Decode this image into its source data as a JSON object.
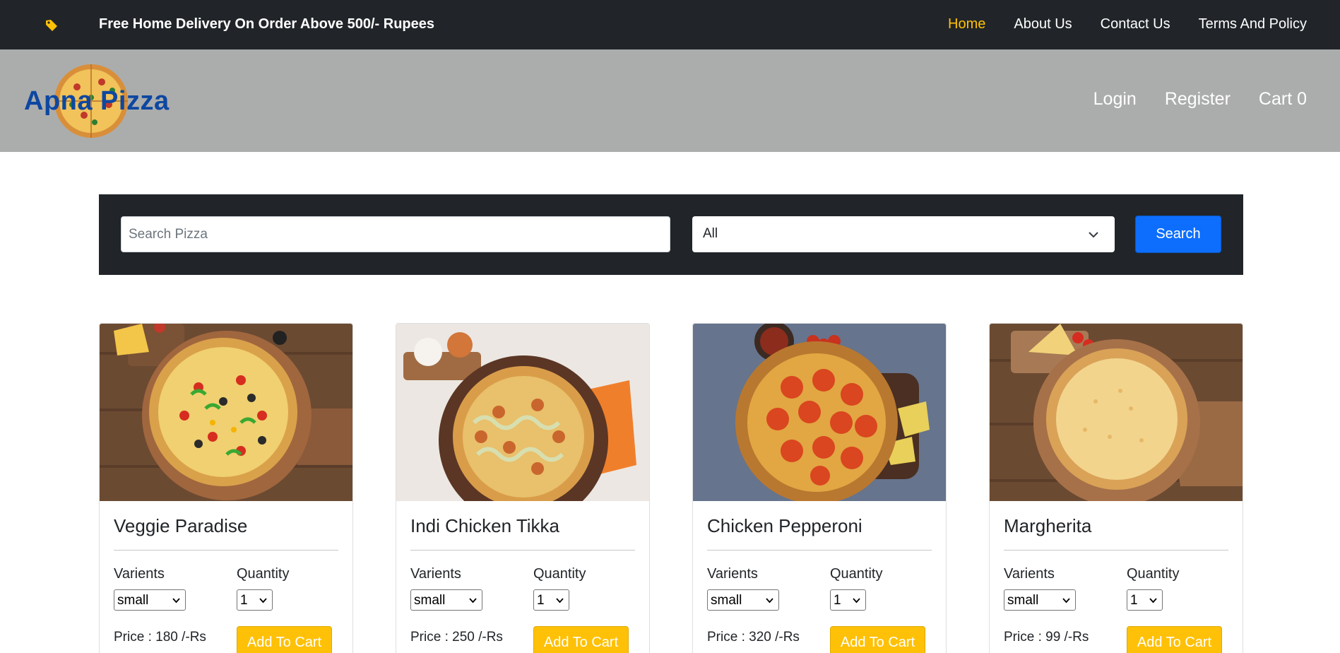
{
  "topbar": {
    "icon": "tag-icon",
    "promo": "Free Home Delivery On Order Above 500/- Rupees",
    "nav": [
      {
        "label": "Home",
        "active": true
      },
      {
        "label": "About Us",
        "active": false
      },
      {
        "label": "Contact Us",
        "active": false
      },
      {
        "label": "Terms And Policy",
        "active": false
      }
    ]
  },
  "brand": {
    "name": "Apna Pizza",
    "logo_icon": "pizza-logo-icon"
  },
  "auth": {
    "login": "Login",
    "register": "Register",
    "cart": "Cart 0"
  },
  "search": {
    "placeholder": "Search Pizza",
    "value": "",
    "category": "All",
    "button": "Search"
  },
  "labels": {
    "variants": "Varients",
    "quantity": "Quantity",
    "add_to_cart": "Add To Cart"
  },
  "products": [
    {
      "name": "Veggie Paradise",
      "variant": "small",
      "quantity": "1",
      "price": "Price : 180 /-Rs",
      "image": "veggie-paradise-pizza-image"
    },
    {
      "name": "Indi Chicken Tikka",
      "variant": "small",
      "quantity": "1",
      "price": "Price : 250 /-Rs",
      "image": "indi-chicken-tikka-pizza-image"
    },
    {
      "name": "Chicken Pepperoni",
      "variant": "small",
      "quantity": "1",
      "price": "Price : 320 /-Rs",
      "image": "chicken-pepperoni-pizza-image"
    },
    {
      "name": "Margherita",
      "variant": "small",
      "quantity": "1",
      "price": "Price : 99 /-Rs",
      "image": "margherita-pizza-image"
    }
  ],
  "colors": {
    "topbar_bg": "#212529",
    "active_nav": "#ffc107",
    "brandbar_bg": "#abadac",
    "brand_text": "#0d47a1",
    "search_button": "#0d6efd",
    "add_to_cart_button": "#ffc107"
  }
}
